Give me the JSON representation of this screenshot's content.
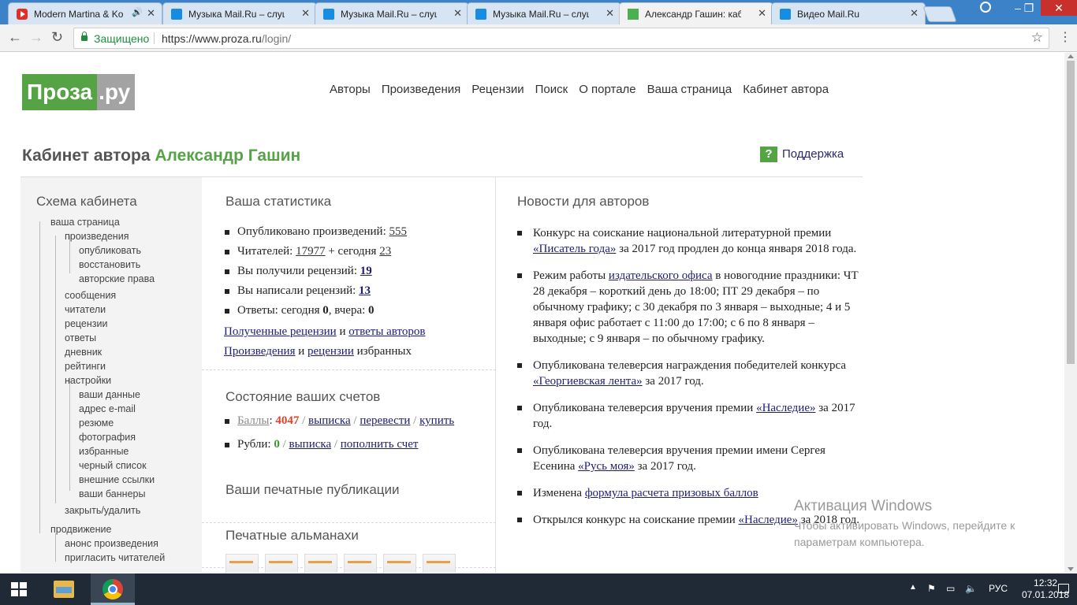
{
  "browser": {
    "tabs": [
      {
        "title": "Modern Martina & Ko",
        "favicon": "youtube-favicon",
        "audio": true
      },
      {
        "title": "Музыка Mail.Ru – слуша",
        "favicon": "mailru-music-favicon",
        "audio": false
      },
      {
        "title": "Музыка Mail.Ru – слуша",
        "favicon": "mailru-music-favicon",
        "audio": false
      },
      {
        "title": "Музыка Mail.Ru – слуша",
        "favicon": "mailru-music-favicon",
        "audio": false
      },
      {
        "title": "Александр Гашин: каби",
        "favicon": "proza-favicon",
        "audio": false,
        "active": true
      },
      {
        "title": "Видео Mail.Ru",
        "favicon": "mailru-video-favicon",
        "audio": false
      }
    ],
    "secure_label": "Защищено",
    "url_base": "https://www.proza.ru",
    "url_path": "/login/"
  },
  "site": {
    "logo_left": "Проза",
    "logo_right": ".ру",
    "nav": [
      "Авторы",
      "Произведения",
      "Рецензии",
      "Поиск",
      "О портале",
      "Ваша страница",
      "Кабинет автора"
    ],
    "cabinet_prefix": "Кабинет автора",
    "author_name": "Александр Гашин",
    "support_icon_text": "?",
    "support_label": "Поддержка"
  },
  "sidebar": {
    "title": "Схема кабинета",
    "items": [
      {
        "label": "ваша страница",
        "level": 1
      },
      {
        "label": "произведения",
        "level": 2
      },
      {
        "label": "опубликовать",
        "level": 3
      },
      {
        "label": "восстановить",
        "level": 3
      },
      {
        "label": "авторские права",
        "level": 3
      },
      {
        "label": "сообщения",
        "level": 2
      },
      {
        "label": "читатели",
        "level": 2
      },
      {
        "label": "рецензии",
        "level": 2
      },
      {
        "label": "ответы",
        "level": 2
      },
      {
        "label": "дневник",
        "level": 2
      },
      {
        "label": "рейтинги",
        "level": 2
      },
      {
        "label": "настройки",
        "level": 2
      },
      {
        "label": "ваши данные",
        "level": 3
      },
      {
        "label": "адрес e-mail",
        "level": 3
      },
      {
        "label": "резюме",
        "level": 3
      },
      {
        "label": "фотография",
        "level": 3
      },
      {
        "label": "избранные",
        "level": 3
      },
      {
        "label": "черный список",
        "level": 3
      },
      {
        "label": "внешние ссылки",
        "level": 3
      },
      {
        "label": "ваши баннеры",
        "level": 3
      },
      {
        "label": "закрыть/удалить",
        "level": 2
      },
      {
        "label": "продвижение",
        "level": 1
      },
      {
        "label": "анонс произведения",
        "level": 2
      },
      {
        "label": "пригласить читателей",
        "level": 2
      }
    ]
  },
  "stats": {
    "title": "Ваша статистика",
    "published_label": "Опубликовано произведений:",
    "published_value": "555",
    "readers_label": "Читателей:",
    "readers_value": "17977",
    "readers_plus": "+ сегодня",
    "readers_today": "23",
    "received_label": "Вы получили рецензий:",
    "received_value": "19",
    "written_label": "Вы написали рецензий:",
    "written_value": "13",
    "answers_label": "Ответы: сегодня",
    "answers_today": "0",
    "answers_sep": ", вчера:",
    "answers_yesterday": "0",
    "link_received_reviews": "Полученные рецензии",
    "and1": "и",
    "link_author_answers": "ответы авторов",
    "link_works": "Произведения",
    "and2": "и",
    "link_reviews": "рецензии",
    "favorites_suffix": "избранных"
  },
  "accounts": {
    "title": "Состояние ваших счетов",
    "points_label": "Баллы",
    "points_value": "4047",
    "statement": "выписка",
    "transfer": "перевести",
    "buy": "купить",
    "rubles_label": "Рубли:",
    "rubles_value": "0",
    "statement2": "выписка",
    "topup": "пополнить счет",
    "sep": "/"
  },
  "print_pubs": {
    "title": "Ваши печатные публикации"
  },
  "almanacs": {
    "title": "Печатные альманахи",
    "count": 6
  },
  "news": {
    "title": "Новости для авторов",
    "items": [
      {
        "before": "Конкурс на соискание национальной литературной премии ",
        "link": "«Писатель года»",
        "after": " за 2017 год продлен до конца января 2018 года."
      },
      {
        "before": "Режим работы ",
        "link": "издательского офиса",
        "after": " в новогодние праздники: ЧТ 28 декабря – короткий день до 18:00; ПТ 29 декабря – по обычному графику; с 30 декабря по 3 января – выходные; 4 и 5 января офис работает с 11:00 до 17:00; с 6 по 8 января – выходные; с 9 января – по обычному графику."
      },
      {
        "before": "Опубликована телеверсия награждения победителей конкурса ",
        "link": "«Георгиевская лента»",
        "after": " за 2017 год."
      },
      {
        "before": "Опубликована телеверсия вручения премии ",
        "link": "«Наследие»",
        "after": " за 2017 год."
      },
      {
        "before": "Опубликована телеверсия вручения премии имени Сергея Есенина ",
        "link": "«Русь моя»",
        "after": " за 2017 год."
      },
      {
        "before": "Изменена ",
        "link": "формула расчета призовых баллов",
        "after": ""
      },
      {
        "before": "Открылся конкурс на соискание премии ",
        "link": "«Наследие»",
        "after": " за 2018 год."
      }
    ]
  },
  "watermark": {
    "title": "Активация Windows",
    "line1": "Чтобы активировать Windows, перейдите к",
    "line2": "параметрам компьютера."
  },
  "taskbar": {
    "language": "РУС",
    "time": "12:32",
    "date": "07.01.2018"
  }
}
